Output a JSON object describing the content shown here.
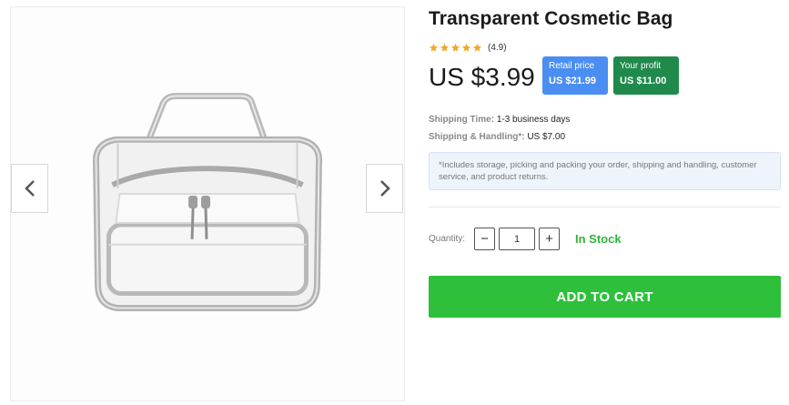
{
  "product": {
    "title": "Transparent Cosmetic Bag",
    "rating_text": "(4.9)",
    "rating_value": 4.9,
    "rating_max": 5,
    "price": "US $3.99"
  },
  "badges": {
    "retail_label": "Retail price",
    "retail_value": "US $21.99",
    "profit_label": "Your profit",
    "profit_value": "US $11.00"
  },
  "shipping": {
    "time_label": "Shipping Time:",
    "time_value": "1-3 business days",
    "handling_label": "Shipping & Handling*:",
    "handling_value": "US $7.00",
    "note": "*Includes storage, picking and packing your order, shipping and handling, customer service, and product returns."
  },
  "quantity": {
    "label": "Quantity:",
    "value": "1",
    "minus": "−",
    "plus": "+"
  },
  "stock_status": "In Stock",
  "cart_button": "ADD TO CART",
  "colors": {
    "star": "#f5a623",
    "retail_badge": "#4a8ef2",
    "profit_badge": "#1f8a4c",
    "stock": "#2fb43a",
    "cart_button": "#2ec03a"
  },
  "icons": {
    "prev": "chevron-left-icon",
    "next": "chevron-right-icon",
    "star": "star-icon"
  }
}
